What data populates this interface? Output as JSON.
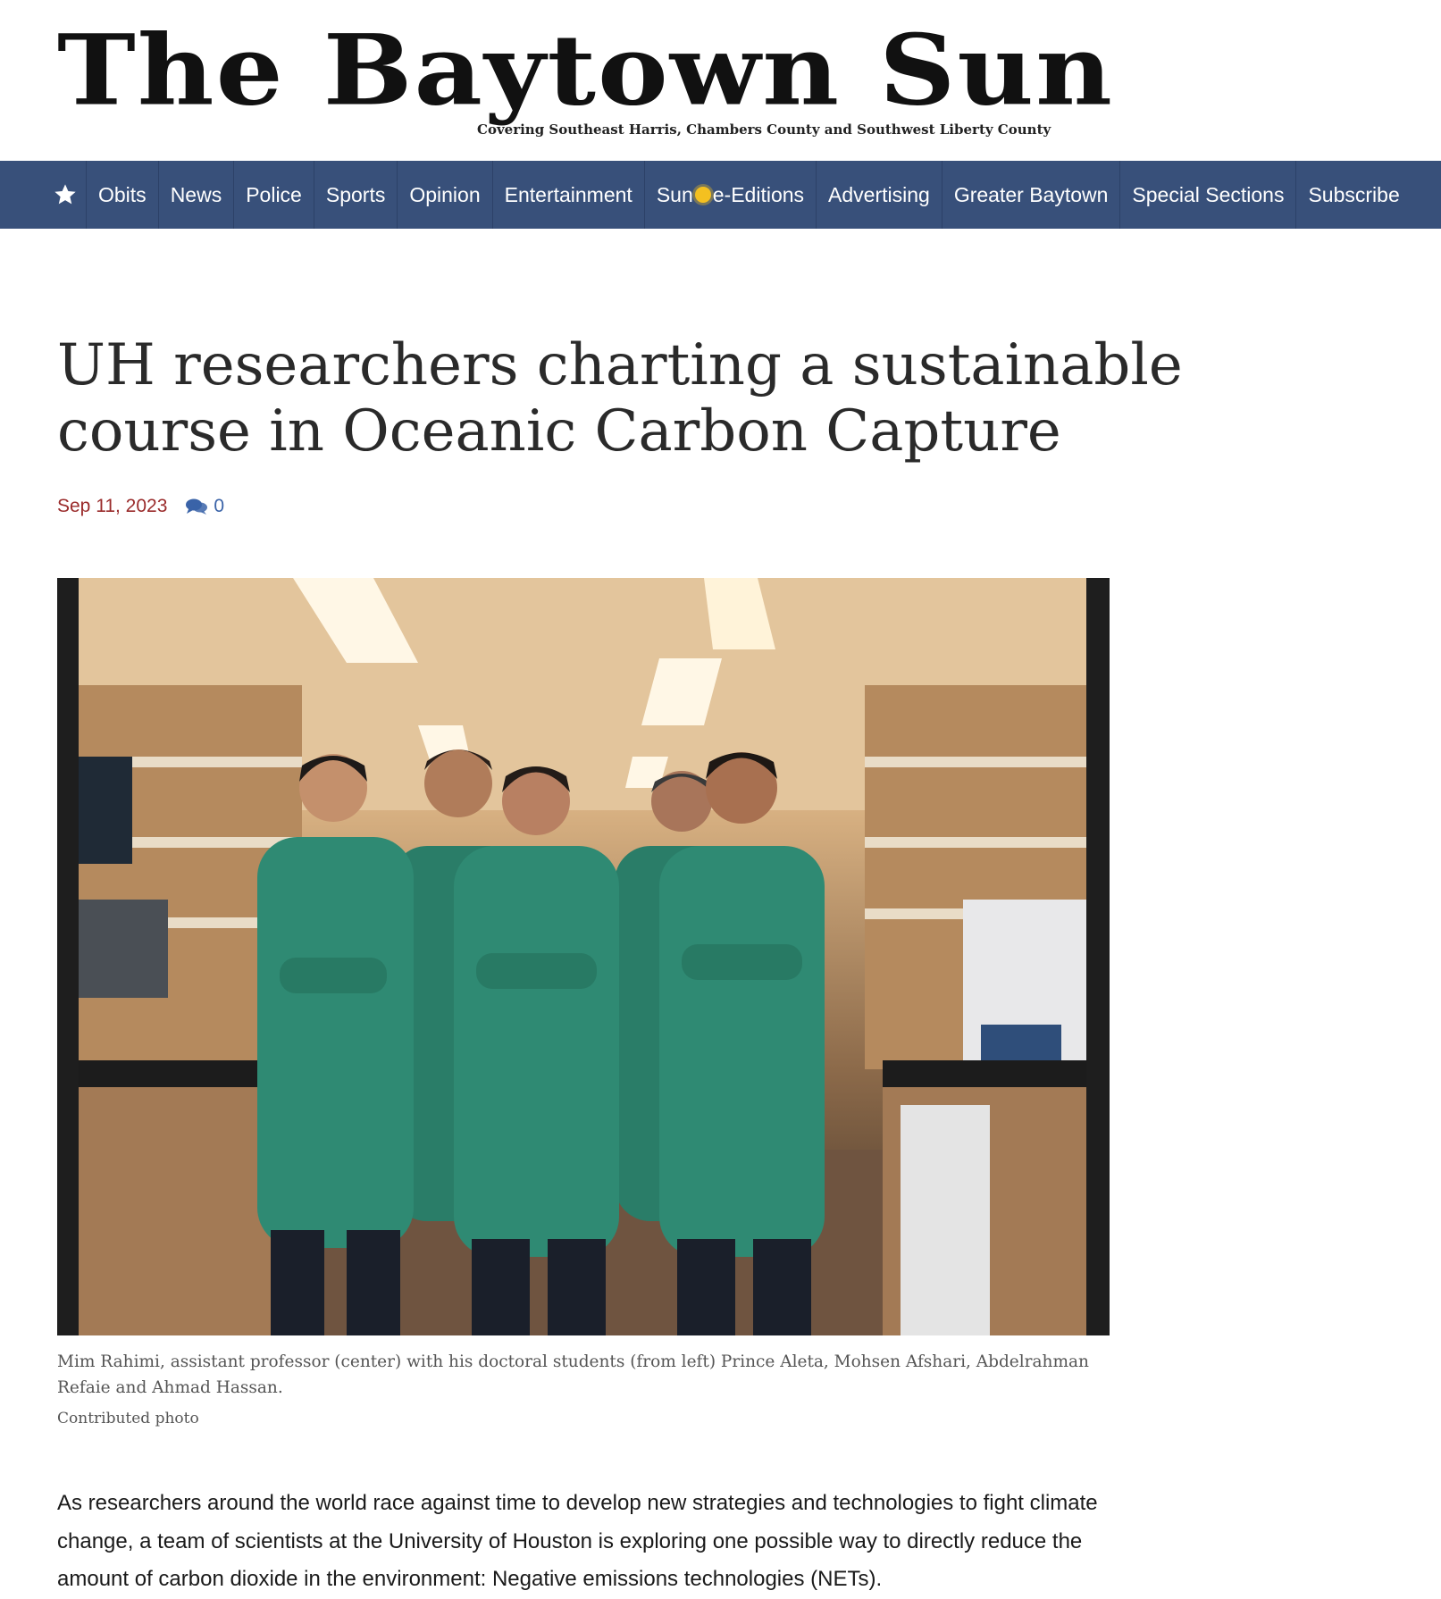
{
  "masthead": {
    "title": "The Baytown Sun",
    "tagline": "Covering Southeast Harris, Chambers County and Southwest Liberty County"
  },
  "nav": {
    "home_icon": "star-icon",
    "items": [
      "Obits",
      "News",
      "Police",
      "Sports",
      "Opinion",
      "Entertainment",
      "Sun",
      "e-Editions",
      "Advertising",
      "Greater Baytown",
      "Special Sections",
      "Subscribe"
    ]
  },
  "article": {
    "headline": "UH researchers charting a sustainable course in Oceanic Carbon Capture",
    "date": "Sep 11, 2023",
    "comment_count": "0",
    "caption": "Mim Rahimi, assistant professor (center) with his doctoral students (from left) Prince Aleta, Mohsen Afshari, Abdelrahman Refaie and Ahmad Hassan.",
    "credit": "Contributed photo",
    "body": "As researchers around the world race against time to develop new strategies and technologies to fight climate change, a team of scientists at the University of Houston is exploring one possible way to directly reduce the amount of carbon dioxide in the environment: Negative emissions technologies (NETs)."
  },
  "colors": {
    "nav_bg": "#38507a",
    "date": "#9a2b2b",
    "comments": "#3a63a8",
    "coat_green": "#2f8a73"
  }
}
